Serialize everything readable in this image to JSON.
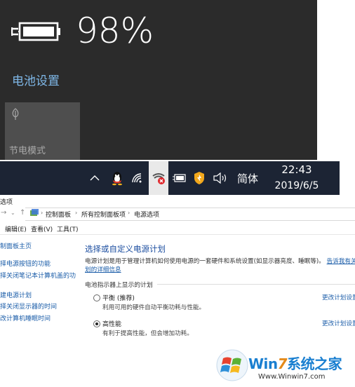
{
  "battery_flyout": {
    "percent": "98%",
    "settings_link": "电池设置",
    "battery_saver_label": "节电模式"
  },
  "taskbar": {
    "ime": "简体",
    "time": "22:43",
    "date": "2019/6/5",
    "icons": [
      "chevron-up-icon",
      "qq-icon",
      "wifi-icon",
      "network-error-icon",
      "battery-icon",
      "shield-icon",
      "volume-icon"
    ]
  },
  "window": {
    "title": "选项",
    "breadcrumb": [
      "控制面板",
      "所有控制面板项",
      "电源选项"
    ],
    "menu": [
      "编辑(E)",
      "查看(V)",
      "工具(T)"
    ],
    "sidebar": [
      "制面板主页",
      "择电源按钮的功能",
      "择关闭笔记本计算机盖的功",
      "建电源计划",
      "择关闭显示器的时间",
      "改计算机睡眠时间"
    ],
    "main": {
      "title": "选择或自定义电源计划",
      "desc_line1": "电源计划是用于管理计算机如何使用电源的一套硬件和系统设置(如显示器亮度、睡眠等)。",
      "desc_link": "告诉我有关电源",
      "desc_line2": "划的详细信息",
      "group_label": "电池指示器上显示的计划",
      "plans": [
        {
          "name": "平衡 (推荐)",
          "desc": "利用可用的硬件自动平衡功耗与性能。",
          "edit": "更改计划设置",
          "selected": false
        },
        {
          "name": "高性能",
          "desc": "有利于提高性能，但会增加功耗。",
          "edit": "更改计划设置",
          "selected": true
        }
      ]
    }
  },
  "watermark": {
    "brand_win": "Win",
    "brand_seven": "7",
    "brand_rest": "系统之家",
    "url": "Www.Winwin7.com"
  },
  "colors": {
    "flyout_bg": "#2b2b2b",
    "taskbar_bg": "#1c2434",
    "link_blue": "#1a5ca8",
    "settings_blue": "#7fb8e8"
  }
}
